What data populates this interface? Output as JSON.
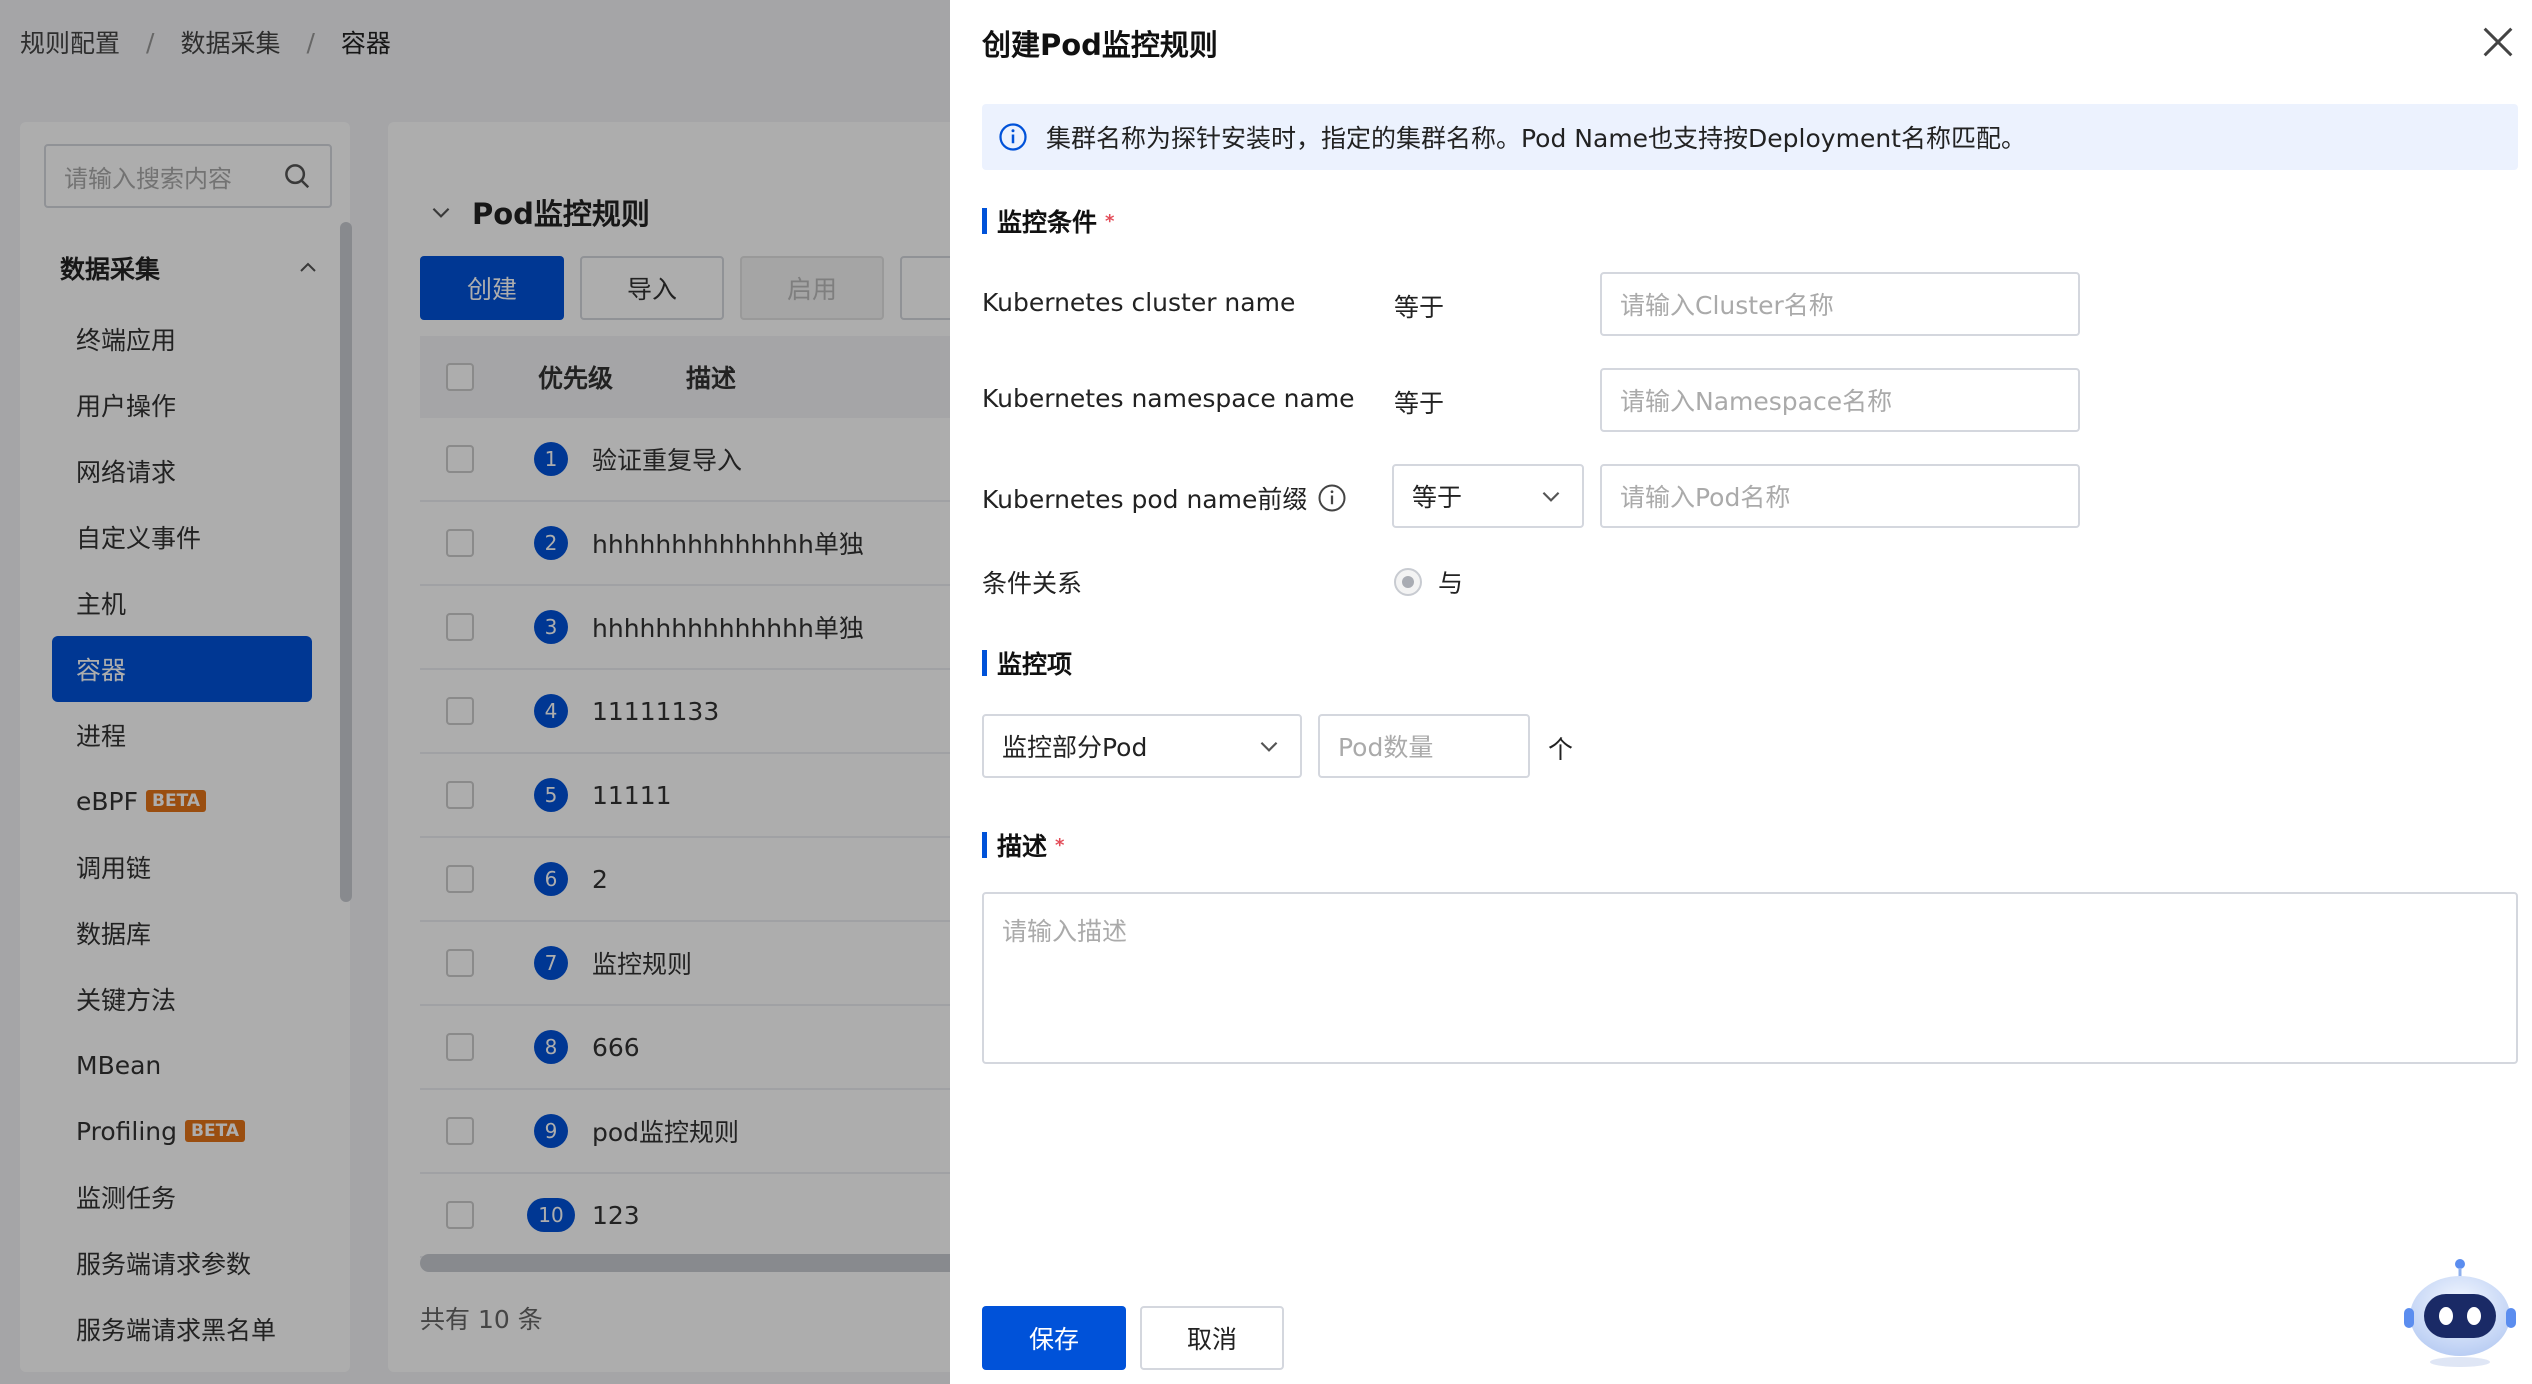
{
  "breadcrumb": {
    "items": [
      "规则配置",
      "数据采集",
      "容器"
    ],
    "separator": "/"
  },
  "sidebar": {
    "search_placeholder": "请输入搜索内容",
    "group_title": "数据采集",
    "items": [
      {
        "label": "终端应用"
      },
      {
        "label": "用户操作"
      },
      {
        "label": "网络请求"
      },
      {
        "label": "自定义事件"
      },
      {
        "label": "主机"
      },
      {
        "label": "容器",
        "active": true
      },
      {
        "label": "进程"
      },
      {
        "label": "eBPF",
        "badge": "BETA"
      },
      {
        "label": "调用链"
      },
      {
        "label": "数据库"
      },
      {
        "label": "关键方法"
      },
      {
        "label": "MBean"
      },
      {
        "label": "Profiling",
        "badge": "BETA"
      },
      {
        "label": "监测任务"
      },
      {
        "label": "服务端请求参数"
      },
      {
        "label": "服务端请求黑名单"
      }
    ]
  },
  "content": {
    "section_title": "Pod监控规则",
    "buttons": {
      "create": "创建",
      "import": "导入",
      "enable": "启用"
    },
    "columns": {
      "priority": "优先级",
      "description": "描述"
    },
    "rows": [
      {
        "priority": "1",
        "description": "验证重复导入"
      },
      {
        "priority": "2",
        "description": "hhhhhhhhhhhhhh单独"
      },
      {
        "priority": "3",
        "description": "hhhhhhhhhhhhhh单独"
      },
      {
        "priority": "4",
        "description": "11111133"
      },
      {
        "priority": "5",
        "description": "11111"
      },
      {
        "priority": "6",
        "description": "2"
      },
      {
        "priority": "7",
        "description": "监控规则"
      },
      {
        "priority": "8",
        "description": "666"
      },
      {
        "priority": "9",
        "description": "pod监控规则"
      },
      {
        "priority": "10",
        "description": "123"
      }
    ],
    "total": "共有 10 条"
  },
  "drawer": {
    "title": "创建Pod监控规则",
    "alert": "集群名称为探针安装时，指定的集群名称。Pod Name也支持按Deployment名称匹配。",
    "conditions": {
      "title": "监控条件",
      "required_mark": "*",
      "cluster": {
        "label": "Kubernetes cluster name",
        "operator": "等于",
        "placeholder": "请输入Cluster名称"
      },
      "namespace": {
        "label": "Kubernetes namespace name",
        "operator": "等于",
        "placeholder": "请输入Namespace名称"
      },
      "pod": {
        "label": "Kubernetes pod name前缀",
        "operator": "等于",
        "placeholder": "请输入Pod名称"
      },
      "relation": {
        "label": "条件关系",
        "option": "与"
      }
    },
    "monitor": {
      "title": "监控项",
      "select_value": "监控部分Pod",
      "count_placeholder": "Pod数量",
      "unit": "个"
    },
    "description": {
      "title": "描述",
      "required_mark": "*",
      "placeholder": "请输入描述"
    },
    "actions": {
      "save": "保存",
      "cancel": "取消"
    }
  },
  "colors": {
    "primary": "#0052d9",
    "beta": "#e37318",
    "required": "#e34d59"
  }
}
